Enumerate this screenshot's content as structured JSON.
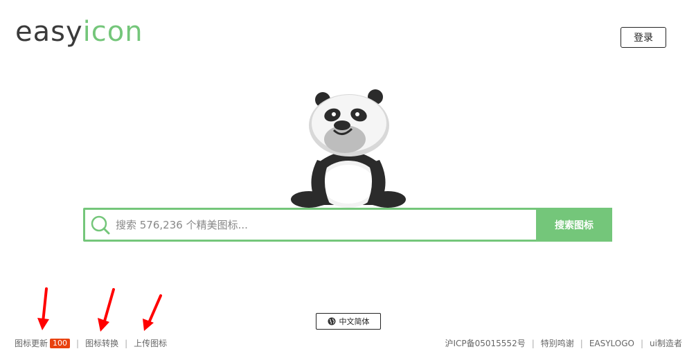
{
  "logo": {
    "part1": "easy",
    "part2": "icon"
  },
  "header": {
    "login_label": "登录"
  },
  "search": {
    "placeholder": "搜索 576,236 个精美图标...",
    "button_label": "搜索图标"
  },
  "language": {
    "label": "中文简体"
  },
  "footer": {
    "left": [
      {
        "label": "图标更新",
        "badge": "100"
      },
      {
        "label": "图标转换"
      },
      {
        "label": "上传图标"
      }
    ],
    "right": [
      {
        "label": "沪ICP备05015552号"
      },
      {
        "label": "特别鸣谢"
      },
      {
        "label": "EASYLOGO"
      },
      {
        "label": "ui制造者"
      }
    ],
    "separator": "|"
  },
  "colors": {
    "accent": "#74c67a",
    "badge": "#e8410f",
    "annotation": "#ff0000"
  },
  "icons": [
    "search-icon",
    "globe-icon",
    "panda-mascot",
    "red-arrow"
  ]
}
